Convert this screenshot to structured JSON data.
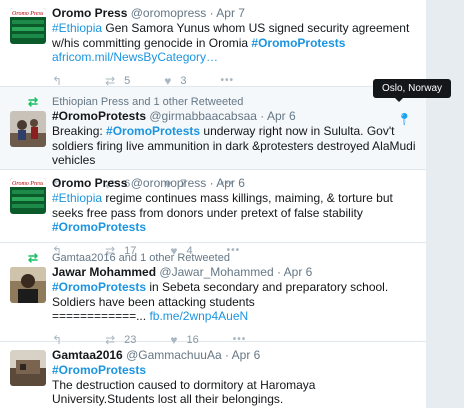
{
  "tweets": [
    {
      "name": "Oromo Press",
      "handle": "@oromopress",
      "sep": "·",
      "time": "Apr 7",
      "t1_tag": "#Ethiopia",
      "t1_rest": " Gen Samora Yunus whom US signed security agreement w/his committing genocide in Oromia ",
      "t1_tag2": "#OromoProtests",
      "link": "africom.mil/NewsByCategory…",
      "retweets": "5",
      "likes": "3"
    },
    {
      "context": "Ethiopian Press and 1 other Retweeted",
      "name": "#OromoProtests",
      "handle": "@girmabbaacabsaa",
      "sep": "·",
      "time": "Apr 6",
      "t_pre": "Breaking: ",
      "t_tag": "#OromoProtests",
      "t_rest": " underway right now in Sululta. Gov't soldiers firing live ammunition in dark &protesters destroyed AlaMudi vehicles",
      "retweets": "6",
      "likes": "7",
      "location_tooltip": "Oslo, Norway"
    },
    {
      "name": "Oromo Press",
      "handle": "@oromopress",
      "sep": "·",
      "time": "Apr 6",
      "t_tag": "#Ethiopia",
      "t_rest": " regime continues mass killings, maiming, & torture but seeks free pass from donors under pretext of false stability ",
      "t_tag2": "#OromoProtests",
      "retweets": "17",
      "likes": "4"
    },
    {
      "context": "Gamtaa2016 and 1 other Retweeted",
      "name": "Jawar Mohammed",
      "handle": "@Jawar_Mohammed",
      "sep": "·",
      "time": "Apr 6",
      "t_tag": "#OromoProtests",
      "t_rest": " in Sebeta secondary and preparatory school. Soldiers have been attacking students",
      "t_line3": "============... ",
      "link": "fb.me/2wnp4AueN",
      "retweets": "23",
      "likes": "16"
    },
    {
      "name": "Gamtaa2016",
      "handle": "@GammachuuAa",
      "sep": "·",
      "time": "Apr 6",
      "t_tag": "#OromoProtests",
      "t_rest": " The destruction caused to dormitory at Haromaya University.Students lost all their belongings."
    }
  ],
  "icons": {
    "reply": "reply-icon",
    "retweet": "retweet-icon",
    "like": "heart-icon",
    "more": "more-icon"
  },
  "colors": {
    "link": "#1b95e0",
    "retweet_green": "#17bf63",
    "highlight_bg": "#f5f8fa"
  }
}
